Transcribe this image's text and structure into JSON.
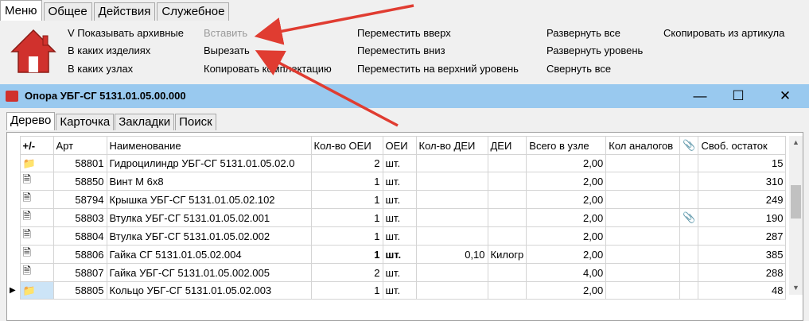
{
  "menu_tabs": [
    "Меню",
    "Общее",
    "Действия",
    "Служебное"
  ],
  "ribbon": {
    "show_archived": "V Показывать архивные",
    "in_products": "В каких изделиях",
    "in_nodes": "В каких узлах",
    "paste": "Вставить",
    "cut": "Вырезать",
    "copy_kit": "Копировать комплектацию",
    "move_up": "Переместить вверх",
    "move_down": "Переместить вниз",
    "move_top": "Переместить на верхний уровень",
    "expand_all": "Развернуть все",
    "expand_level": "Развернуть уровень",
    "collapse_all": "Свернуть все",
    "copy_from_article": "Скопировать из артикула"
  },
  "window": {
    "title": "Опора УБГ-СГ 5131.01.05.00.000"
  },
  "subtabs": [
    "Дерево",
    "Карточка",
    "Закладки",
    "Поиск"
  ],
  "grid": {
    "headers": [
      "+/-",
      "Арт",
      "Наименование",
      "Кол-во ОЕИ",
      "ОЕИ",
      "Кол-во ДЕИ",
      "ДЕИ",
      "Всего в узле",
      "Кол аналогов",
      "",
      "Своб. остаток"
    ],
    "rows": [
      {
        "icon": "folder-open",
        "art": "58801",
        "name": "Гидроцилиндр УБГ-СГ 5131.01.05.02.0",
        "qty": "2",
        "unit": "шт.",
        "qty2": "",
        "unit2": "",
        "total": "2,00",
        "analogs": "",
        "clip": false,
        "stock": "15",
        "bold": false,
        "current": false
      },
      {
        "icon": "doc",
        "art": "58850",
        "name": "Винт  М 6х8",
        "qty": "1",
        "unit": "шт.",
        "qty2": "",
        "unit2": "",
        "total": "2,00",
        "analogs": "",
        "clip": false,
        "stock": "310",
        "bold": false,
        "current": false
      },
      {
        "icon": "doc",
        "art": "58794",
        "name": "Крышка      УБГ-СГ 5131.01.05.02.102",
        "qty": "1",
        "unit": "шт.",
        "qty2": "",
        "unit2": "",
        "total": "2,00",
        "analogs": "",
        "clip": false,
        "stock": "249",
        "bold": false,
        "current": false
      },
      {
        "icon": "doc",
        "art": "58803",
        "name": "Втулка УБГ-СГ 5131.01.05.02.001",
        "qty": "1",
        "unit": "шт.",
        "qty2": "",
        "unit2": "",
        "total": "2,00",
        "analogs": "",
        "clip": true,
        "stock": "190",
        "bold": false,
        "current": false
      },
      {
        "icon": "doc",
        "art": "58804",
        "name": "Втулка УБГ-СГ 5131.01.05.02.002",
        "qty": "1",
        "unit": "шт.",
        "qty2": "",
        "unit2": "",
        "total": "2,00",
        "analogs": "",
        "clip": false,
        "stock": "287",
        "bold": false,
        "current": false
      },
      {
        "icon": "doc",
        "art": "58806",
        "name": "Гайка СГ 5131.01.05.02.004",
        "qty": "1",
        "unit": "шт.",
        "qty2": "0,10",
        "unit2": "Килогр",
        "total": "2,00",
        "analogs": "",
        "clip": false,
        "stock": "385",
        "bold": true,
        "current": false
      },
      {
        "icon": "doc",
        "art": "58807",
        "name": "Гайка УБГ-СГ 5131.01.05.002.005",
        "qty": "2",
        "unit": "шт.",
        "qty2": "",
        "unit2": "",
        "total": "4,00",
        "analogs": "",
        "clip": false,
        "stock": "288",
        "bold": false,
        "current": false
      },
      {
        "icon": "folder",
        "art": "58805",
        "name": "Кольцо     УБГ-СГ 5131.01.05.02.003",
        "qty": "1",
        "unit": "шт.",
        "qty2": "",
        "unit2": "",
        "total": "2,00",
        "analogs": "",
        "clip": false,
        "stock": "48",
        "bold": false,
        "current": true
      }
    ]
  },
  "colors": {
    "titlebar": "#99c9ef",
    "arrow": "#e03c31",
    "house": "#d0312d"
  }
}
